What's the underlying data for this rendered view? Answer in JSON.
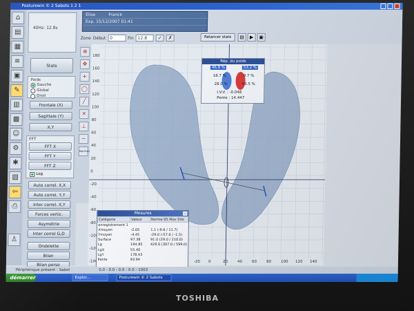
{
  "window": {
    "title": "Posturewin © 2 Sabots 1 2 1"
  },
  "header": {
    "info": [
      "Elise",
      "Franck",
      "Exp. 15/12/2007 01:41"
    ],
    "frequency": "40Hz: 12.8s",
    "zone_label": "Zone",
    "debut_label": "Début",
    "debut_value": "0",
    "fin_label": "Fin",
    "fin_value": "12.8",
    "restat_label": "Relancer stats"
  },
  "side": {
    "top_button": "Stats",
    "poids_label": "Poids",
    "radios": [
      "Gauche",
      "Global",
      "Droit"
    ],
    "buttons": [
      "Frontale (X)",
      "Sagittale (Y)",
      "X,Y"
    ],
    "fft_label": "FFT",
    "fft_buttons": [
      "FFT X",
      "FFT Y",
      "FFT Z"
    ],
    "log_label": "Log",
    "lower_buttons": [
      "Auto correl. X,X",
      "Auto correl. Y,Y",
      "Inter correl. X,Y",
      "Forces vertic.",
      "Asymétrie",
      "Inter correl G,D",
      "Ondelette",
      "Bilan",
      "Bilan perso"
    ],
    "normes_label": "Normes"
  },
  "plot": {
    "y_ticks": [
      "180",
      "160",
      "140",
      "120",
      "100",
      "80",
      "60",
      "40",
      "20",
      "0",
      "-20",
      "-40",
      "-60",
      "-80",
      "-100",
      "-120",
      "-140"
    ],
    "x_ticks": [
      "-20",
      "0",
      "20",
      "40",
      "60",
      "80",
      "100",
      "120",
      "140"
    ]
  },
  "weight": {
    "title": "Rép. du poids",
    "top_left": "46.8 %",
    "top_right": "53.2 %",
    "mid_left": "18.7 %",
    "mid_right": "9.7 %",
    "bot_left": "28.0 %",
    "bot_right": "43.5 %",
    "ivv": "I.V.V. : -0.048",
    "pente": "Pente : 14.447"
  },
  "measures": {
    "title": "Mesures",
    "headers": [
      "Catégorie",
      "Valeur",
      "Norme 05 Mov 5Hz"
    ],
    "section": "enregistrement 1",
    "rows": [
      [
        "Xmoyen",
        "-2.05",
        "1.1 (-9.6 / 11.7)"
      ],
      [
        "Ymoyen",
        "-4.45",
        "-29.0 (-57.0 / -1.5)"
      ],
      [
        "Surface",
        "97.38",
        "91.0 (29.0 / 210.0)"
      ],
      [
        "Lg",
        "194.85",
        "429.0 (307.0 / 599.0)"
      ],
      [
        "LgX",
        "55.40",
        ""
      ],
      [
        "LgY",
        "178.43",
        ""
      ],
      [
        "Pente",
        "93.94",
        ""
      ]
    ]
  },
  "status": {
    "text": "Périphérique présent : Sabot",
    "coords": "0.0 - 0.0 - 0.0 - 0.0 - 1003"
  },
  "taskbar": {
    "start": "démarrer",
    "task1": "Explor...",
    "task2": "Posturewin © 2 Sabots"
  },
  "laptop": {
    "brand": "TOSHIBA"
  },
  "colors": {
    "plot_bg": "#e4e9ef",
    "foot": "#8ea5c3",
    "accent_red": "#d83b3b",
    "accent_blue": "#3a67c8"
  }
}
